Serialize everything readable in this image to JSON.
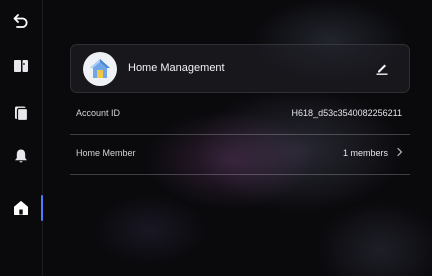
{
  "sidebar": {
    "items": [
      {
        "name": "back",
        "icon": "back-arrow-icon"
      },
      {
        "name": "devices",
        "icon": "panel-icon"
      },
      {
        "name": "messages",
        "icon": "card-stack-icon"
      },
      {
        "name": "notifications",
        "icon": "bell-icon"
      },
      {
        "name": "home",
        "icon": "home-icon",
        "active": true
      }
    ],
    "active_color": "#4d7cff"
  },
  "home_card": {
    "title": "Home Management",
    "avatar_icon": "house-avatar-icon",
    "edit_icon": "edit-pencil-icon"
  },
  "rows": {
    "account_id": {
      "label": "Account ID",
      "value": "H618_d53c3540082256211"
    },
    "home_member": {
      "label": "Home Member",
      "value": "1 members"
    }
  }
}
